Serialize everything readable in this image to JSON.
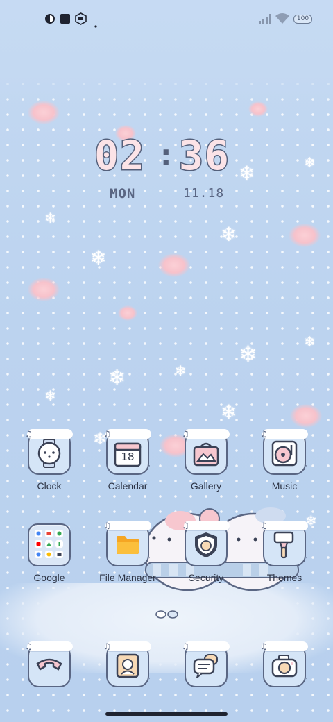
{
  "status_bar": {
    "icons_left": [
      "app-indicator-icon",
      "square-notification-icon",
      "hexagon-notification-icon",
      "dot-icon"
    ],
    "icons_right": [
      "signal-icon",
      "wifi-icon",
      "battery-icon"
    ],
    "battery_level": "100"
  },
  "clock_widget": {
    "hours": "02",
    "separator": ":",
    "minutes": "36",
    "day": "MON",
    "date": "11.18"
  },
  "apps_row1": [
    {
      "label": "Clock",
      "icon": "watch-icon"
    },
    {
      "label": "Calendar",
      "icon": "calendar-icon",
      "badge": "18"
    },
    {
      "label": "Gallery",
      "icon": "gallery-icon"
    },
    {
      "label": "Music",
      "icon": "music-record-icon"
    }
  ],
  "apps_row2": [
    {
      "label": "Google",
      "icon": "google-folder-icon"
    },
    {
      "label": "File Manager",
      "icon": "folder-icon"
    },
    {
      "label": "Security",
      "icon": "shield-icon"
    },
    {
      "label": "Themes",
      "icon": "paintbrush-icon"
    }
  ],
  "dock": [
    {
      "icon": "phone-icon"
    },
    {
      "icon": "contacts-icon"
    },
    {
      "icon": "messages-icon"
    },
    {
      "icon": "camera-icon"
    }
  ],
  "page_indicator": {
    "pages": 2,
    "current": 1
  },
  "colors": {
    "background": "#bcd3ef",
    "tile": "#d5e5f7",
    "outline": "#5a6683",
    "pink": "#fbe3e7",
    "label_text": "#2d3445",
    "folder_orange": "#f5a623"
  }
}
